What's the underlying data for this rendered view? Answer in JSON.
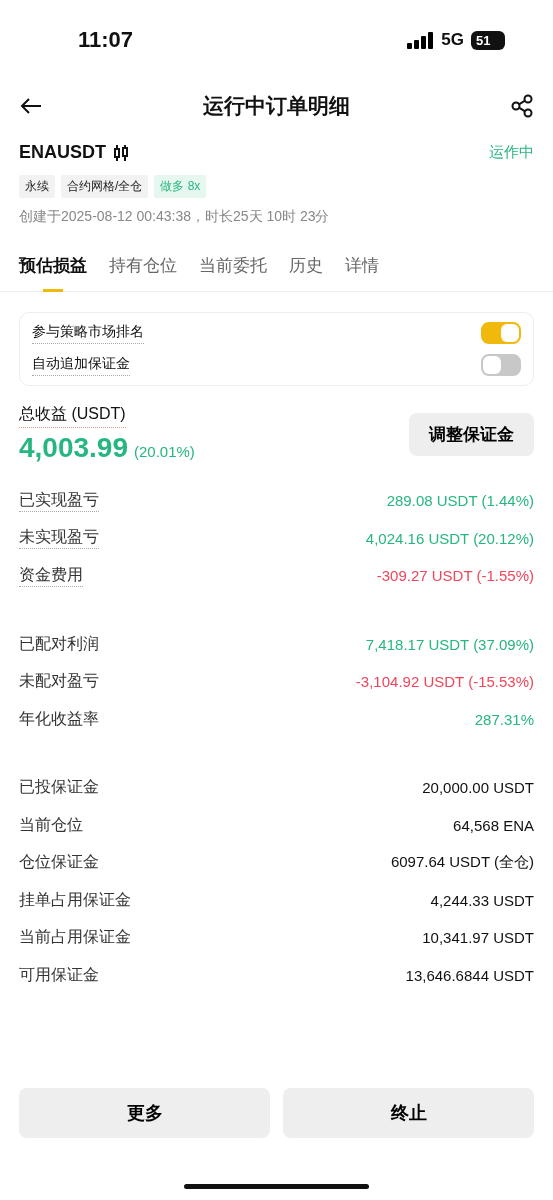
{
  "status_bar": {
    "time": "11:07",
    "network": "5G",
    "battery": "51"
  },
  "header": {
    "title": "运行中订单明细"
  },
  "order": {
    "symbol": "ENAUSDT",
    "status": "运作中",
    "tags": [
      {
        "label": "永续",
        "kind": "plain"
      },
      {
        "label": "合约网格/全仓",
        "kind": "plain"
      },
      {
        "label": "做多 8x",
        "kind": "long"
      }
    ],
    "created": "创建于2025-08-12 00:43:38，时长25天 10时 23分"
  },
  "tabs": [
    {
      "label": "预估损益",
      "selected": true
    },
    {
      "label": "持有仓位",
      "selected": false
    },
    {
      "label": "当前委托",
      "selected": false
    },
    {
      "label": "历史",
      "selected": false
    },
    {
      "label": "详情",
      "selected": false
    }
  ],
  "settings": [
    {
      "label": "参与策略市场排名",
      "on": true
    },
    {
      "label": "自动追加保证金",
      "on": false
    }
  ],
  "total": {
    "label": "总收益 (USDT)",
    "value": "4,003.99",
    "percent": "(20.01%)",
    "button": "调整保证金"
  },
  "groups": [
    [
      {
        "label": "已实现盈亏",
        "value": "289.08 USDT (1.44%)",
        "kind": "positive"
      },
      {
        "label": "未实现盈亏",
        "value": "4,024.16 USDT (20.12%)",
        "kind": "positive"
      },
      {
        "label": "资金费用",
        "value": "-309.27 USDT (-1.55%)",
        "kind": "negative"
      }
    ],
    [
      {
        "label": "已配对利润",
        "value": "7,418.17 USDT (37.09%)",
        "kind": "positive"
      },
      {
        "label": "未配对盈亏",
        "value": "-3,104.92 USDT (-15.53%)",
        "kind": "negative"
      },
      {
        "label": "年化收益率",
        "value": "287.31%",
        "kind": "positive"
      }
    ],
    [
      {
        "label": "已投保证金",
        "value": "20,000.00 USDT",
        "kind": "neutral"
      },
      {
        "label": "当前仓位",
        "value": "64,568 ENA",
        "kind": "neutral"
      },
      {
        "label": "仓位保证金",
        "value": "6097.64 USDT (全仓)",
        "kind": "neutral"
      },
      {
        "label": "挂单占用保证金",
        "value": "4,244.33 USDT",
        "kind": "neutral"
      },
      {
        "label": "当前占用保证金",
        "value": "10,341.97 USDT",
        "kind": "neutral"
      },
      {
        "label": "可用保证金",
        "value": "13,646.6844 USDT",
        "kind": "neutral"
      }
    ]
  ],
  "buttons": [
    "更多",
    "终止"
  ]
}
